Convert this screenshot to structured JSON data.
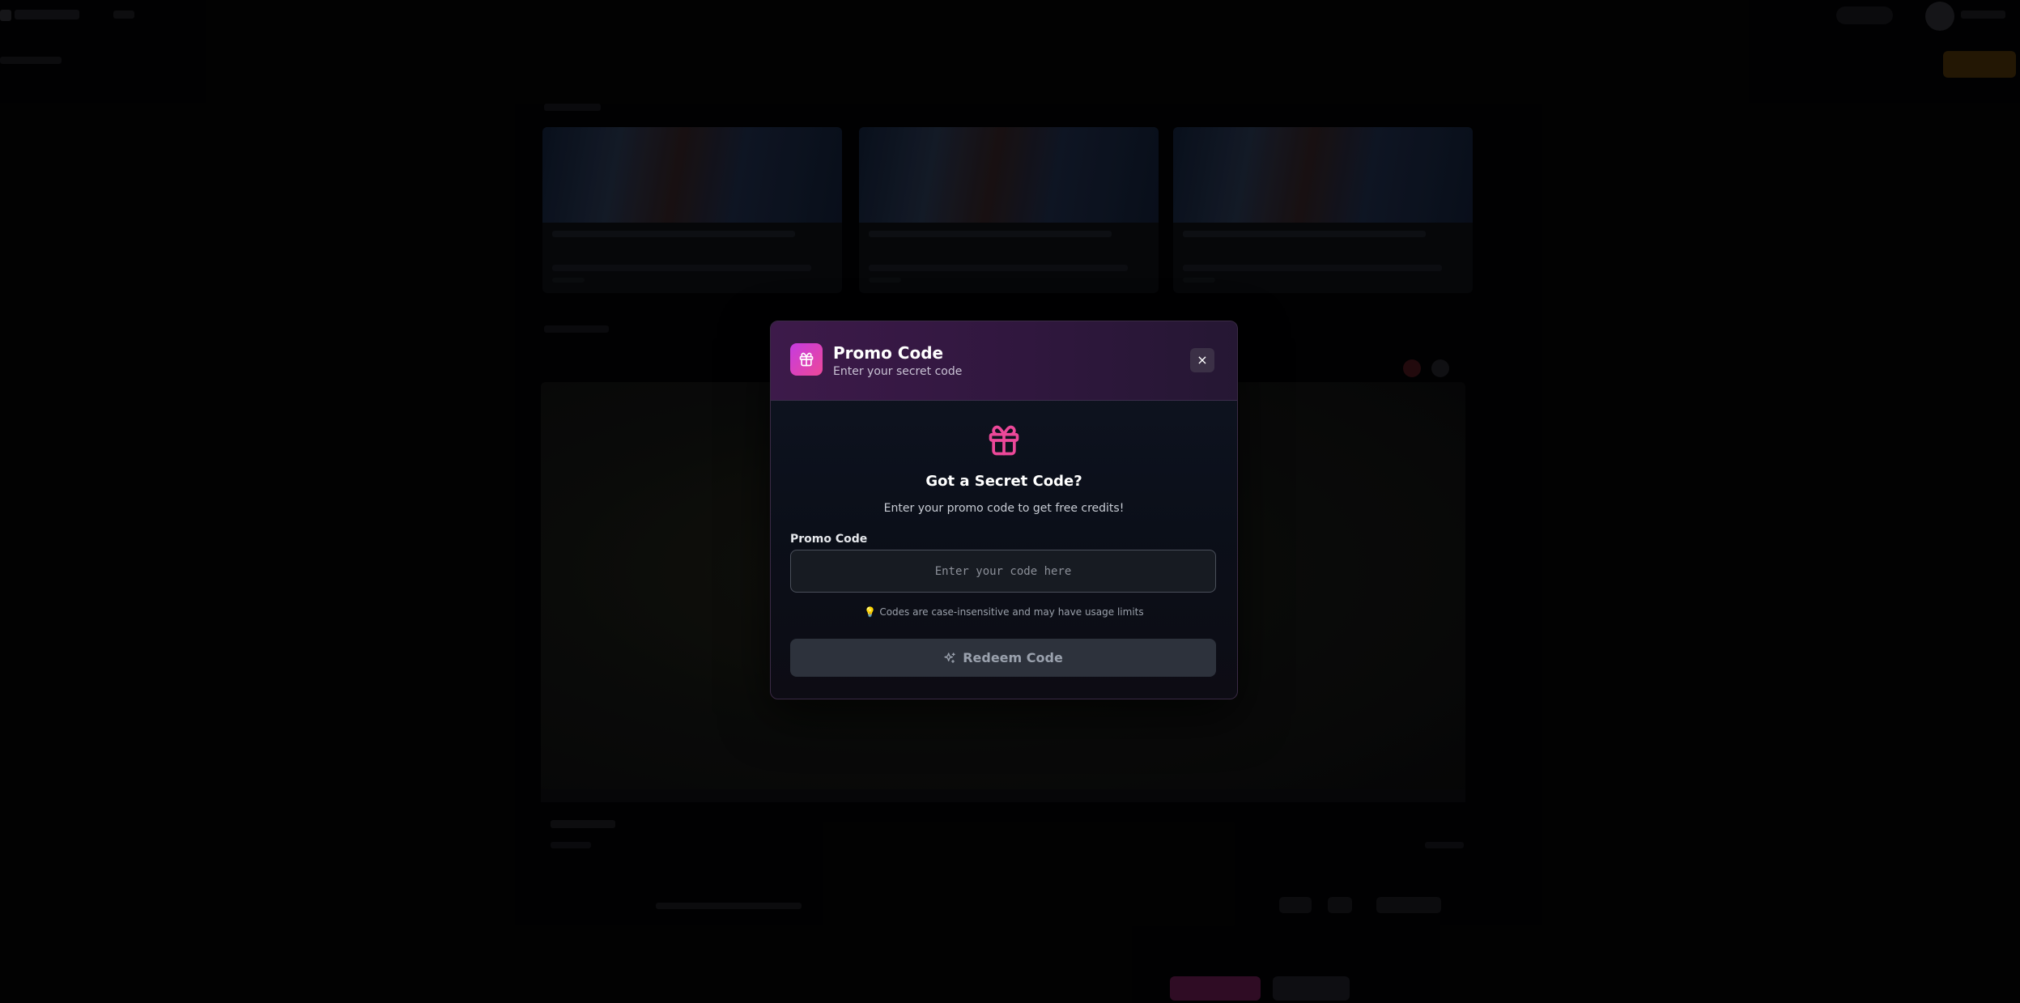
{
  "modal": {
    "title": "Promo Code",
    "subtitle": "Enter your secret code",
    "close_label": "×",
    "heading": "Got a Secret Code?",
    "description": "Enter your promo code to get free credits!",
    "field_label": "Promo Code",
    "input_value": "",
    "input_placeholder": "Enter your code here",
    "hint_icon": "lightbulb-icon",
    "hint_text": "Codes are case-insensitive and may have usage limits",
    "redeem_label": "Redeem Code",
    "redeem_icon": "sparkles-icon",
    "header_icon": "gift-icon",
    "accent_color": "#ec4899"
  }
}
